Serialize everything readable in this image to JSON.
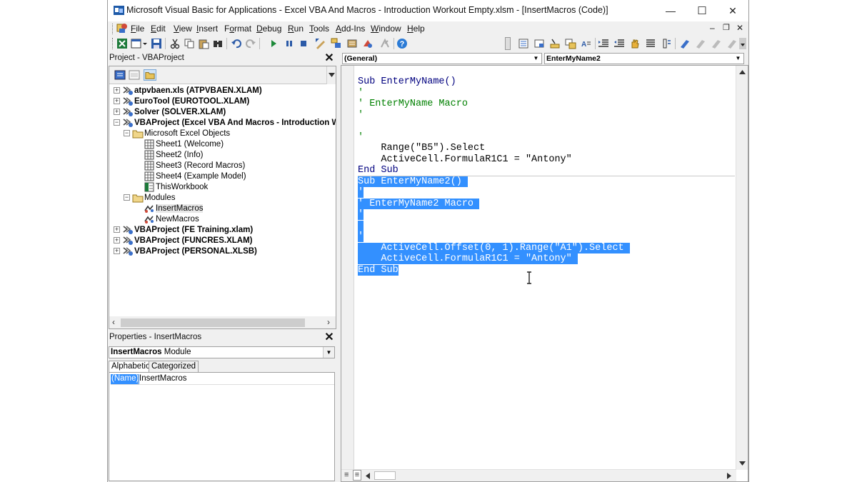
{
  "window": {
    "title": "Microsoft Visual Basic for Applications - Excel VBA And Macros - Introduction Workout Empty.xlsm - [InsertMacros (Code)]",
    "minimize_glyph": "—",
    "maximize_glyph": "☐",
    "close_glyph": "✕"
  },
  "menu": {
    "items": [
      {
        "label": "File",
        "accel": "F",
        "rest": "ile"
      },
      {
        "label": "Edit",
        "accel": "E",
        "rest": "dit"
      },
      {
        "label": "View",
        "accel": "V",
        "rest": "iew"
      },
      {
        "label": "Insert",
        "accel": "I",
        "rest": "nsert"
      },
      {
        "label": "Format",
        "accel": "o",
        "pre": "F",
        "rest": "rmat"
      },
      {
        "label": "Debug",
        "accel": "D",
        "rest": "ebug"
      },
      {
        "label": "Run",
        "accel": "R",
        "rest": "un"
      },
      {
        "label": "Tools",
        "accel": "T",
        "rest": "ools"
      },
      {
        "label": "Add-Ins",
        "accel": "A",
        "rest": "dd-Ins"
      },
      {
        "label": "Window",
        "accel": "W",
        "rest": "indow"
      },
      {
        "label": "Help",
        "accel": "H",
        "rest": "elp"
      }
    ],
    "mdi_minimize": "–",
    "mdi_restore": "❐",
    "mdi_close": "✕"
  },
  "project": {
    "title": "Project - VBAProject",
    "close": "✕",
    "tree": [
      {
        "label": "atpvbaen.xls (ATPVBAEN.XLAM)",
        "level": 0,
        "expander": "+",
        "icon": "vbaproject-icon",
        "bold": true
      },
      {
        "label": "EuroTool (EUROTOOL.XLAM)",
        "level": 0,
        "expander": "+",
        "icon": "vbaproject-icon",
        "bold": true
      },
      {
        "label": "Solver (SOLVER.XLAM)",
        "level": 0,
        "expander": "+",
        "icon": "vbaproject-icon",
        "bold": true
      },
      {
        "label": "VBAProject (Excel VBA And Macros - Introduction W",
        "level": 0,
        "expander": "−",
        "icon": "vbaproject-icon",
        "bold": true
      },
      {
        "label": "Microsoft Excel Objects",
        "level": 1,
        "expander": "−",
        "icon": "folder-icon",
        "bold": false
      },
      {
        "label": "Sheet1 (Welcome)",
        "level": 2,
        "expander": "",
        "icon": "worksheet-icon",
        "bold": false
      },
      {
        "label": "Sheet2 (Info)",
        "level": 2,
        "expander": "",
        "icon": "worksheet-icon",
        "bold": false
      },
      {
        "label": "Sheet3 (Record Macros)",
        "level": 2,
        "expander": "",
        "icon": "worksheet-icon",
        "bold": false
      },
      {
        "label": "Sheet4 (Example Model)",
        "level": 2,
        "expander": "",
        "icon": "worksheet-icon",
        "bold": false
      },
      {
        "label": "ThisWorkbook",
        "level": 2,
        "expander": "",
        "icon": "workbook-icon",
        "bold": false
      },
      {
        "label": "Modules",
        "level": 1,
        "expander": "−",
        "icon": "folder-icon",
        "bold": false
      },
      {
        "label": "InsertMacros",
        "level": 2,
        "expander": "",
        "icon": "module-icon",
        "bold": false,
        "selected": true
      },
      {
        "label": "NewMacros",
        "level": 2,
        "expander": "",
        "icon": "module-icon",
        "bold": false
      },
      {
        "label": "VBAProject (FE Training.xlam)",
        "level": 0,
        "expander": "+",
        "icon": "vbaproject-icon",
        "bold": true
      },
      {
        "label": "VBAProject (FUNCRES.XLAM)",
        "level": 0,
        "expander": "+",
        "icon": "vbaproject-icon",
        "bold": true
      },
      {
        "label": "VBAProject (PERSONAL.XLSB)",
        "level": 0,
        "expander": "+",
        "icon": "vbaproject-icon",
        "bold": true
      }
    ],
    "scroll_left": "‹",
    "scroll_right": "›"
  },
  "properties": {
    "title": "Properties - InsertMacros",
    "close": "✕",
    "object_name": "InsertMacros",
    "object_type": "Module",
    "tabs": [
      "Alphabetic",
      "Categorized"
    ],
    "rows": [
      {
        "name": "(Name)",
        "value": "InsertMacros"
      }
    ]
  },
  "code": {
    "object_combo": "(General)",
    "procedure_combo": "EnterMyName2",
    "lines": [
      {
        "text": "Sub EnterMyName()",
        "type": "kw",
        "selected": false
      },
      {
        "text": "'",
        "type": "cm",
        "selected": false
      },
      {
        "text": "' EnterMyName Macro",
        "type": "cm",
        "selected": false
      },
      {
        "text": "'",
        "type": "cm",
        "selected": false
      },
      {
        "text": "",
        "type": "plain",
        "selected": false
      },
      {
        "text": "'",
        "type": "cm",
        "selected": false
      },
      {
        "text": "    Range(\"B5\").Select",
        "type": "plain",
        "selected": false
      },
      {
        "text": "    ActiveCell.FormulaR1C1 = \"Antony\"",
        "type": "plain",
        "selected": false
      },
      {
        "text": "End Sub",
        "type": "kw",
        "selected": false
      },
      {
        "text": "Sub EnterMyName2() ",
        "type": "kw",
        "selected": true
      },
      {
        "text": "'",
        "type": "cm",
        "selected": true
      },
      {
        "text": "' EnterMyName2 Macro ",
        "type": "cm",
        "selected": true
      },
      {
        "text": "'",
        "type": "cm",
        "selected": true
      },
      {
        "text": " ",
        "type": "plain",
        "selected": true
      },
      {
        "text": "'",
        "type": "cm",
        "selected": true
      },
      {
        "text": "    ActiveCell.Offset(0, 1).Range(\"A1\").Select ",
        "type": "plain",
        "selected": true
      },
      {
        "text": "    ActiveCell.FormulaR1C1 = \"Antony\" ",
        "type": "plain",
        "selected": true
      },
      {
        "text": "End Sub",
        "type": "kw",
        "selected": true
      }
    ],
    "view_procedure_glyph": "≡",
    "view_full_glyph": "≡"
  },
  "colors": {
    "keyword": "#00007f",
    "comment": "#008000",
    "selection": "#3390ff"
  }
}
